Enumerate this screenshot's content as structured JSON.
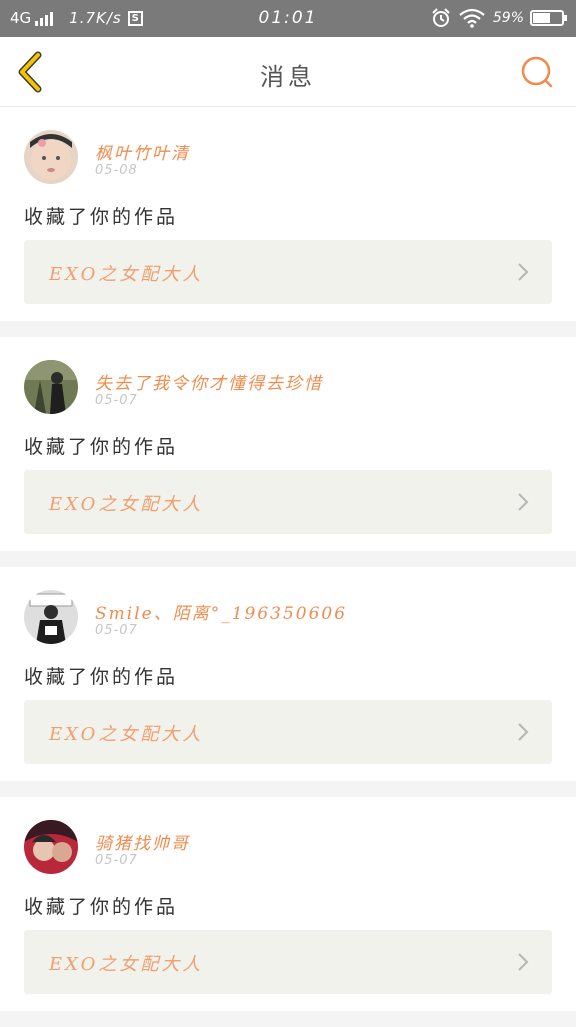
{
  "status_bar": {
    "network": "4G",
    "speed": "1.7K/s",
    "time": "01:01",
    "battery": "59%",
    "battery_level": 0.59
  },
  "nav": {
    "title": "消息"
  },
  "colors": {
    "accent": "#f08c4e",
    "back_arrow": "#f5c400",
    "card_box": "#f2f2ec"
  },
  "messages": [
    {
      "user": "枫叶竹叶清",
      "date": "05-08",
      "text": "收藏了你的作品",
      "work_title": "EXO之女配大人"
    },
    {
      "user": "失去了我令你才懂得去珍惜",
      "date": "05-07",
      "text": "收藏了你的作品",
      "work_title": "EXO之女配大人"
    },
    {
      "user": "Smile、陌离°_196350606",
      "date": "05-07",
      "text": "收藏了你的作品",
      "work_title": "EXO之女配大人"
    },
    {
      "user": "骑猪找帅哥",
      "date": "05-07",
      "text": "收藏了你的作品",
      "work_title": "EXO之女配大人"
    }
  ]
}
